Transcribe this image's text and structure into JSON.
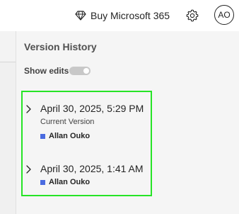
{
  "header": {
    "buy_label": "Buy Microsoft 365",
    "buy_icon": "diamond-icon",
    "settings_icon": "gear-icon",
    "avatar_initials": "AO"
  },
  "panel": {
    "title": "Version History",
    "show_edits_label": "Show edits",
    "show_edits_on": false,
    "versions": [
      {
        "date": "April 30, 2025, 5:29 PM",
        "subtitle": "Current Version",
        "author": "Allan Ouko"
      },
      {
        "date": "April 30, 2025, 1:41 AM",
        "author": "Allan Ouko"
      }
    ]
  },
  "colors": {
    "highlight_border": "#26e426",
    "author_swatch": "#4a6be0",
    "panel_background": "#f5f5f5"
  }
}
